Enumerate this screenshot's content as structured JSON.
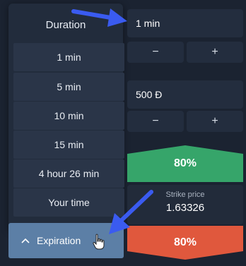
{
  "duration_dropdown": {
    "title": "Duration",
    "options": [
      "1 min",
      "5 min",
      "10 min",
      "15 min",
      "4 hour 26 min",
      "Your time"
    ]
  },
  "expiration_button": {
    "label": "Expiration",
    "icon": "chevron-up-icon"
  },
  "time_field": {
    "value": "1 min"
  },
  "time_stepper": {
    "minus": "−",
    "plus": "+"
  },
  "amount_field": {
    "value": "500 Ð"
  },
  "amount_stepper": {
    "minus": "−",
    "plus": "+"
  },
  "up_button": {
    "label": "80%",
    "color": "#36a56a"
  },
  "strike": {
    "label": "Strike price",
    "value": "1.63326"
  },
  "down_button": {
    "label": "80%",
    "color": "#e0583d"
  },
  "annotations": {
    "arrow_color": "#3a5bf0"
  }
}
